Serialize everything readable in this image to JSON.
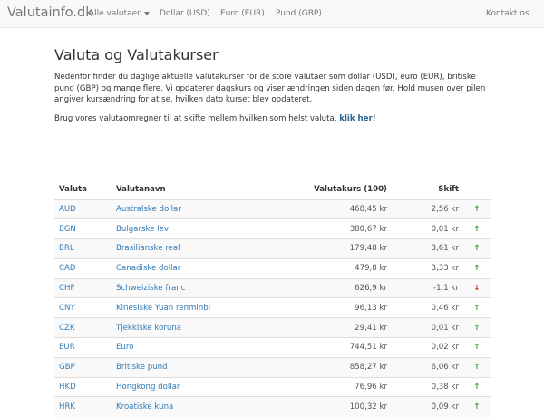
{
  "navbar": {
    "brand": "Valutainfo.dk",
    "items": [
      "Alle valutaer",
      "Dollar (USD)",
      "Euro (EUR)",
      "Pund (GBP)"
    ],
    "contact": "Kontakt os"
  },
  "page": {
    "title": "Valuta og Valutakurser",
    "intro": "Nedenfor finder du daglige aktuelle valutakurser for de store valutaer som dollar (USD), euro (EUR), britiske pund (GBP) og mange flere. Vi opdaterer dagskurs og viser ændringen siden dagen før. Hold musen over pilen angiver kursændring for at se, hvilken dato kurset blev opdateret.",
    "cta_text": "Brug vores valutaomregner til at skifte mellem hvilken som helst valuta,",
    "cta_link": "klik her!"
  },
  "table": {
    "headers": [
      "Valuta",
      "Valutanavn",
      "Valutakurs (100)",
      "Skift",
      ""
    ],
    "rows": [
      {
        "code": "AUD",
        "name": "Australske dollar",
        "rate": "468,45 kr",
        "change": "2,56 kr",
        "arrow": "↑",
        "dir": "up"
      },
      {
        "code": "BGN",
        "name": "Bulgarske lev",
        "rate": "380,67 kr",
        "change": "0,01 kr",
        "arrow": "↑",
        "dir": "up"
      },
      {
        "code": "BRL",
        "name": "Brasilianske real",
        "rate": "179,48 kr",
        "change": "3,61 kr",
        "arrow": "↑",
        "dir": "up"
      },
      {
        "code": "CAD",
        "name": "Canadiske dollar",
        "rate": "479,8 kr",
        "change": "3,33 kr",
        "arrow": "↑",
        "dir": "up"
      },
      {
        "code": "CHF",
        "name": "Schweiziske franc",
        "rate": "626,9 kr",
        "change": "-1,1 kr",
        "arrow": "↓",
        "dir": "down"
      },
      {
        "code": "CNY",
        "name": "Kinesiske Yuan renminbi",
        "rate": "96,13 kr",
        "change": "0,46 kr",
        "arrow": "↑",
        "dir": "up"
      },
      {
        "code": "CZK",
        "name": "Tjekkiske koruna",
        "rate": "29,41 kr",
        "change": "0,01 kr",
        "arrow": "↑",
        "dir": "up"
      },
      {
        "code": "EUR",
        "name": "Euro",
        "rate": "744,51 kr",
        "change": "0,02 kr",
        "arrow": "↑",
        "dir": "up"
      },
      {
        "code": "GBP",
        "name": "Britiske pund",
        "rate": "858,27 kr",
        "change": "6,06 kr",
        "arrow": "↑",
        "dir": "up"
      },
      {
        "code": "HKD",
        "name": "Hongkong dollar",
        "rate": "76,96 kr",
        "change": "0,38 kr",
        "arrow": "↑",
        "dir": "up"
      },
      {
        "code": "HRK",
        "name": "Kroatiske kuna",
        "rate": "100,32 kr",
        "change": "0,09 kr",
        "arrow": "↑",
        "dir": "up"
      }
    ]
  }
}
